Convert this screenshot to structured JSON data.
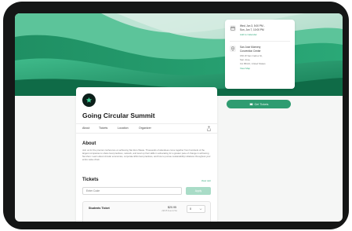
{
  "event": {
    "title": "Going Circular Summit"
  },
  "tabs": [
    "About",
    "Tickets",
    "Location",
    "Organizer"
  ],
  "about": {
    "heading": "About",
    "text": "Join us for the premier conference on achieving Net Zero Waste. Thousands of attendees come together from hundreds of the largest companies to share best practices, network, and level up their skills in advocating for a greater pace of change in achieving Net Zero. Learn about circular economies, corporate ESG best practices, and how to pursue sustainability initiatives throughout your entire value chain."
  },
  "tickets": {
    "heading": "Tickets",
    "view_calendar": "View cart",
    "code_placeholder": "Enter Code",
    "apply_label": "Apply",
    "items": [
      {
        "name": "Students Ticket",
        "price": "$20.95",
        "fee": "+$5.45 Fees & Tax",
        "qty": "0"
      }
    ]
  },
  "details": {
    "date_line1": "Wed, Jun 3, 5:00 PM -",
    "date_line2": "Sun, Jun 7, 10:00 PM",
    "add_calendar": "Add to Calendar",
    "venue_line1": "San Jose Mcenery",
    "venue_line2": "Convention Center",
    "address_line1": "150 W San Carlos St,",
    "address_line2": "San Jose,",
    "address_line3": "CA 95113, United States",
    "view_map": "View Map"
  },
  "cta": {
    "get_tickets": "Get Tickets"
  },
  "colors": {
    "accent": "#2f9c71",
    "accent_light": "#a9dcc7",
    "device_frame": "#151616"
  }
}
